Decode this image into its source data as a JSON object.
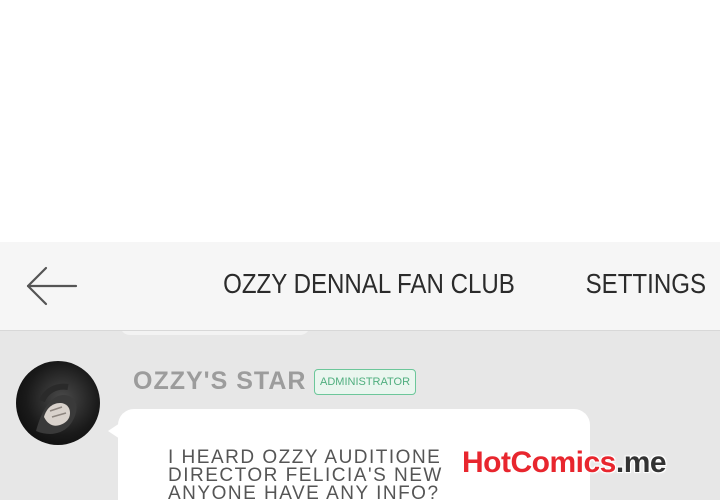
{
  "header": {
    "title": "OZZY DENNAL FAN CLUB",
    "settings_label": "SETTINGS",
    "back_icon": "arrow-left-icon"
  },
  "post": {
    "username": "OZZY'S STAR",
    "badge": "ADMINISTRATOR",
    "avatar": "avatar-hands-dark",
    "message_lines": [
      "I HEARD OZZY AUDITIONE",
      "DIRECTOR FELICIA'S NEW",
      "ANYONE HAVE ANY INFO?"
    ]
  },
  "watermark": {
    "main": "HotComics",
    "tld": ".me"
  },
  "colors": {
    "header_bg": "#f6f6f6",
    "chat_bg": "#e7e7e7",
    "badge_green": "#4fae7e",
    "watermark_red": "#e8262e"
  }
}
